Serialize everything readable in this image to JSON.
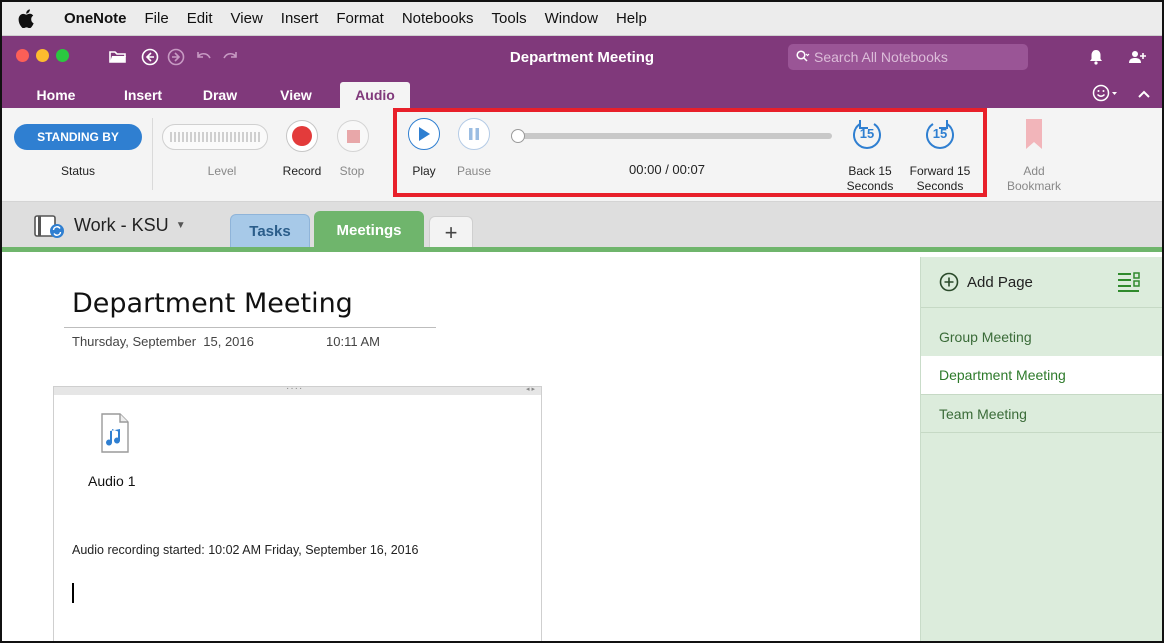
{
  "menubar": {
    "app": "OneNote",
    "items": [
      "File",
      "Edit",
      "View",
      "Insert",
      "Format",
      "Notebooks",
      "Tools",
      "Window",
      "Help"
    ]
  },
  "window": {
    "title": "Department Meeting",
    "search_placeholder": "Search All Notebooks"
  },
  "ribbon_tabs": [
    "Home",
    "Insert",
    "Draw",
    "View",
    "Audio"
  ],
  "active_tab": "Audio",
  "audio": {
    "status_badge": "STANDING BY",
    "status_label": "Status",
    "level_label": "Level",
    "record_label": "Record",
    "stop_label": "Stop",
    "play_label": "Play",
    "pause_label": "Pause",
    "time": "00:00 / 00:07",
    "playback_progress": 0,
    "back_icon_text": "15",
    "back_label_1": "Back 15",
    "back_label_2": "Seconds",
    "forward_icon_text": "15",
    "forward_label_1": "Forward 15",
    "forward_label_2": "Seconds",
    "bookmark_label_1": "Add",
    "bookmark_label_2": "Bookmark"
  },
  "notebook": {
    "name": "Work - KSU",
    "sections": [
      {
        "label": "Tasks",
        "color": "#a7c9e8"
      },
      {
        "label": "Meetings",
        "color": "#6fb56c"
      }
    ],
    "add_section": "+"
  },
  "page": {
    "title": "Department Meeting",
    "date": "Thursday, September  15, 2016",
    "time": "10:11 AM",
    "attachment_name": "Audio 1",
    "recording_note": "Audio recording started: 10:02 AM Friday, September 16, 2016",
    "container_handle": "····",
    "container_resize": "◂ ▸"
  },
  "pages_panel": {
    "add_page": "Add Page",
    "items": [
      "Group Meeting",
      "Department Meeting",
      "Team Meeting"
    ],
    "selected": "Department Meeting"
  },
  "colors": {
    "brand_purple": "#80397b",
    "highlight_red": "#e8202a",
    "record_red": "#e33b3b",
    "play_blue": "#2f7fd1",
    "section_green": "#6fb56c",
    "section_blue": "#a7c9e8",
    "bookmark_pink": "#f2b5ba"
  }
}
